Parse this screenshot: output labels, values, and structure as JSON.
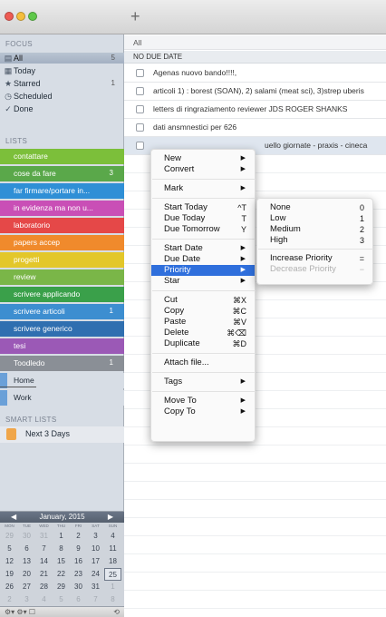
{
  "sidebar": {
    "focus_header": "FOCUS",
    "focus_items": [
      {
        "label": "All",
        "count": "5",
        "icon": "inbox-tray-icon"
      },
      {
        "label": "Today",
        "count": "",
        "icon": "calendar-icon"
      },
      {
        "label": "Starred",
        "count": "1",
        "icon": "star-icon"
      },
      {
        "label": "Scheduled",
        "count": "",
        "icon": "clock-icon"
      },
      {
        "label": "Done",
        "count": "",
        "icon": "checkmark-icon"
      }
    ],
    "lists_header": "LISTS",
    "lists": [
      {
        "label": "contattare",
        "count": "",
        "color": "#7cbf3a"
      },
      {
        "label": "cose da fare",
        "count": "3",
        "color": "#5aa84a"
      },
      {
        "label": "far firmare/portare in...",
        "count": "",
        "color": "#2f8fd6"
      },
      {
        "label": "in evidenza ma non u...",
        "count": "",
        "color": "#c94fb6"
      },
      {
        "label": "laboratorio",
        "count": "",
        "color": "#e54848"
      },
      {
        "label": "papers accep",
        "count": "",
        "color": "#f08a2c"
      },
      {
        "label": "progetti",
        "count": "",
        "color": "#e3c72a"
      },
      {
        "label": "review",
        "count": "",
        "color": "#7ab648"
      },
      {
        "label": "scrivere applicando",
        "count": "",
        "color": "#3aa04a"
      },
      {
        "label": "scrivere articoli",
        "count": "1",
        "color": "#3d8ed0"
      },
      {
        "label": "scrivere generico",
        "count": "",
        "color": "#2f6fb0"
      },
      {
        "label": "tesi",
        "count": "",
        "color": "#9b59b6"
      },
      {
        "label": "Toodledo",
        "count": "1",
        "color": "#8a8f96"
      },
      {
        "label": "Home",
        "count": "",
        "color": "#6aa0d8"
      },
      {
        "label": "Work",
        "count": "",
        "color": "#6aa0d8"
      }
    ],
    "smart_header": "SMART LISTS",
    "smart_items": [
      {
        "label": "Next 3 Days",
        "color": "#f0a64a"
      }
    ]
  },
  "calendar": {
    "month_label": "January, 2015",
    "dow": [
      "MON",
      "TUE",
      "WED",
      "THU",
      "FRI",
      "SAT",
      "SUN"
    ],
    "weeks": [
      [
        "29",
        "30",
        "31",
        "1",
        "2",
        "3",
        "4"
      ],
      [
        "5",
        "6",
        "7",
        "8",
        "9",
        "10",
        "11"
      ],
      [
        "12",
        "13",
        "14",
        "15",
        "16",
        "17",
        "18"
      ],
      [
        "19",
        "20",
        "21",
        "22",
        "23",
        "24",
        "25"
      ],
      [
        "26",
        "27",
        "28",
        "29",
        "30",
        "31",
        "1"
      ],
      [
        "2",
        "3",
        "4",
        "5",
        "6",
        "7",
        "8"
      ]
    ],
    "today": "25"
  },
  "main": {
    "add_label": "+",
    "crumb": "All",
    "group_header": "NO DUE DATE",
    "tasks": [
      "Agenas nuovo bando!!!!,",
      "articoli 1) : borest (SOAN), 2) salami (meat sci), 3)strep uberis",
      "letters di ringraziamento reviewer JDS ROGER SHANKS",
      "dati ansmnestici per 626",
      "uello giornate - praxis - cineca"
    ]
  },
  "context_menu": {
    "items": [
      {
        "label": "New",
        "key": "",
        "sub": true
      },
      {
        "label": "Convert",
        "key": "",
        "sub": true
      },
      {
        "sep": true
      },
      {
        "label": "Mark",
        "key": "",
        "sub": true
      },
      {
        "sep": true
      },
      {
        "label": "Start Today",
        "key": "^T",
        "sub": false
      },
      {
        "label": "Due Today",
        "key": "T",
        "sub": false
      },
      {
        "label": "Due Tomorrow",
        "key": "Y",
        "sub": false
      },
      {
        "sep": true
      },
      {
        "label": "Start Date",
        "key": "",
        "sub": true
      },
      {
        "label": "Due Date",
        "key": "",
        "sub": true
      },
      {
        "label": "Priority",
        "key": "",
        "sub": true,
        "highlight": true
      },
      {
        "label": "Star",
        "key": "",
        "sub": true
      },
      {
        "sep": true
      },
      {
        "label": "Cut",
        "key": "⌘X",
        "sub": false
      },
      {
        "label": "Copy",
        "key": "⌘C",
        "sub": false
      },
      {
        "label": "Paste",
        "key": "⌘V",
        "sub": false
      },
      {
        "label": "Delete",
        "key": "⌘⌫",
        "sub": false
      },
      {
        "label": "Duplicate",
        "key": "⌘D",
        "sub": false
      },
      {
        "sep": true
      },
      {
        "label": "Attach file...",
        "key": "",
        "sub": false
      },
      {
        "sep": true
      },
      {
        "label": "Tags",
        "key": "",
        "sub": true
      },
      {
        "sep": true
      },
      {
        "label": "Move To",
        "key": "",
        "sub": true
      },
      {
        "label": "Copy To",
        "key": "",
        "sub": true
      }
    ]
  },
  "priority_menu": {
    "items": [
      {
        "label": "None",
        "key": "0"
      },
      {
        "label": "Low",
        "key": "1"
      },
      {
        "label": "Medium",
        "key": "2"
      },
      {
        "label": "High",
        "key": "3"
      },
      {
        "sep": true
      },
      {
        "label": "Increase Priority",
        "key": "="
      },
      {
        "label": "Decrease Priority",
        "key": "−",
        "disabled": true
      }
    ]
  },
  "footer": {
    "left_tools": "⚙▾ ⚙▾ ☐",
    "right_tool": "⟲"
  },
  "accent_color": "#2f6fdc"
}
